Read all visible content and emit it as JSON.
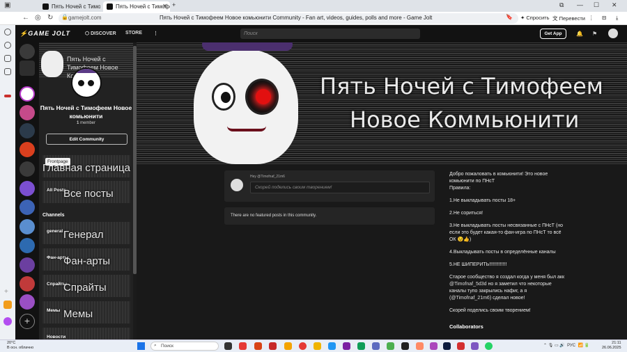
{
  "browser": {
    "tabs": [
      {
        "title": "Пять Ночей с Тимофеем"
      },
      {
        "title": "Пять Ночей с Тимофеем"
      }
    ],
    "url": "gamejolt.com",
    "page_title": "Пять Ночей с Тимофеем Новое комьюнити Community - Fan art, videos, guides, polls and more - Game Jolt",
    "ask_label": "Спросить",
    "translate_label": "Перевести"
  },
  "gamejolt": {
    "logo": "GAME JOLT",
    "discover": "DISCOVER",
    "store": "STORE",
    "search_placeholder": "Поиск",
    "get_app": "Get App"
  },
  "community": {
    "header_name": "Пять Ночей с Тимофеем Новое Комьюнити",
    "name": "Пять Ночей с Тимофеем Новое комьюнити",
    "members_count": "1",
    "members_label": "member",
    "edit_button": "Edit Community",
    "tooltip": "Frontpage",
    "frontpage_big": "Главная страница",
    "all_posts": "All Posts",
    "all_posts_big": "Все посты",
    "channels_heading": "Channels",
    "channels": [
      {
        "small": "general",
        "big": "Генерал"
      },
      {
        "small": "Фан-арты",
        "big": "Фан-арты"
      },
      {
        "small": "Спрайты",
        "big": "Спрайты"
      },
      {
        "small": "Мемы",
        "big": "Мемы"
      },
      {
        "small": "Новости",
        "big": ""
      }
    ]
  },
  "banner": {
    "line1": "Пять Ночей с Тимофеем",
    "line2": "Новое Коммьюнити"
  },
  "post_box": {
    "hey": "Hey @Timofnaf_21m6",
    "placeholder": "Скорей поделись своим творением!"
  },
  "featured_empty": "There are no featured posts in this community.",
  "about": {
    "p1": "Добро пожаловать в комьюнити! Это новое комьюнити по ПНсТ",
    "p1b": "Правила:",
    "rule1": "1.Не выкладывать посты 18+",
    "rule2": "2.Не сориться!",
    "rule3": "3.Не выкладывать посты несвязанные с ПНсТ (но если это будет какая-то фан-игра по ПНсТ то всё ОК 😉👍)",
    "rule4": "4.Выкладывать посты в определённые каналы",
    "rule5": "5.НЕ ШИПЕРИТЬ!!!!!!!!!!!!!",
    "history_a": "Старое сообщество я создал когда у меня был акк",
    "mention_old": "@Timofnaf_5d3d",
    "history_b": "но я заметил что некоторые каналы тупо закрылись нафиг, а я (",
    "mention_new": "@Timofnaf_21m6",
    "history_c": ") сделал новое!",
    "cta": "Скорей поделись своим творением!",
    "collaborators": "Collaborators"
  },
  "taskbar": {
    "temp": "20°C",
    "weather": "В осн. облачно",
    "search": "Поиск",
    "lang": "РУС",
    "time": "21:11",
    "date": "26.06.2025"
  },
  "colors": {
    "gj_bg": "#191919",
    "accent_red": "#e21010"
  }
}
